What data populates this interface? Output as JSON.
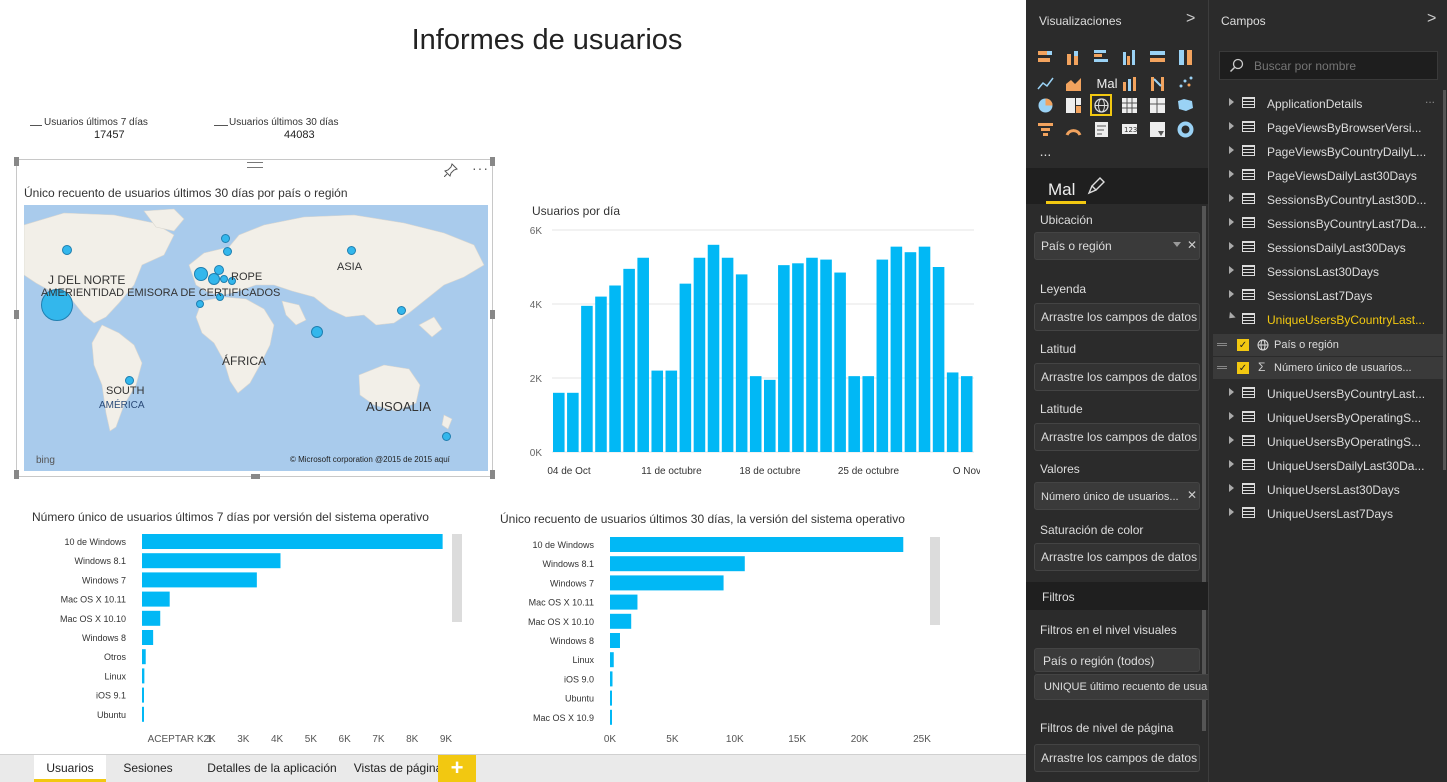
{
  "report": {
    "title": "Informes de usuarios",
    "cards": [
      {
        "label": "Usuarios últimos 7 días",
        "value": "17457"
      },
      {
        "label": "Usuarios últimos 30 días",
        "value": "44083"
      }
    ]
  },
  "map_visual": {
    "title": "Único recuento de usuarios últimos 30 días por país o región",
    "labels": {
      "north_america_1": "J DEL NORTE",
      "north_america_2": "AMERIENTIDAD EMISORA DE CERTIFICADOS",
      "europe": "ROPE",
      "asia": "ASIA",
      "africa": "ÁFRICA",
      "south_1": "SOUTH",
      "south_2": "AMÉRICA",
      "australia": "AUSOALIA",
      "bing": "bing",
      "copyright": "© Microsoft corporation @2015 de 2015 aquí"
    }
  },
  "chart_data": [
    {
      "type": "bar",
      "title": "Usuarios por día",
      "categories": [
        "04 de Oct",
        "",
        "",
        "",
        "",
        "",
        "",
        "11 de octubre",
        "",
        "",
        "",
        "",
        "",
        "",
        "18 de octubre",
        "",
        "",
        "",
        "",
        "",
        "",
        "25 de octubre",
        "",
        "",
        "",
        "",
        "",
        "",
        "O Nov"
      ],
      "x_tick_labels": [
        "04 de Oct",
        "11 de octubre",
        "18 de octubre",
        "25 de octubre",
        "O Nov"
      ],
      "y_tick_labels": [
        "0K",
        "2K",
        "4K",
        "6K"
      ],
      "values": [
        1600,
        1600,
        3950,
        4200,
        4500,
        4950,
        5250,
        2200,
        2200,
        4550,
        5250,
        5600,
        5250,
        4800,
        2050,
        1950,
        5050,
        5100,
        5250,
        5200,
        4850,
        2050,
        2050,
        5200,
        5550,
        5400,
        5550,
        5000,
        2150,
        2050
      ],
      "ylim": [
        0,
        6000
      ],
      "grid": true
    },
    {
      "type": "bar",
      "orientation": "horizontal",
      "title": "Número único de usuarios últimos 7 días por versión del sistema operativo",
      "categories": [
        "10 de Windows",
        "Windows 8.1",
        "Windows 7",
        "Mac OS X 10.11",
        "Mac OS X 10.10",
        "Windows 8",
        "Otros",
        "Linux",
        "iOS 9.1",
        "Ubuntu"
      ],
      "values": [
        8900,
        4100,
        3400,
        820,
        540,
        330,
        110,
        70,
        50,
        30
      ],
      "x_tick_labels": [
        "ACEPTAR K 1",
        "2K",
        "3K",
        "4K",
        "5K",
        "6K",
        "7K",
        "8K",
        "9K"
      ],
      "xlim": [
        0,
        9000
      ]
    },
    {
      "type": "bar",
      "orientation": "horizontal",
      "title": "Único recuento de usuarios últimos 30 días, la versión del sistema operativo",
      "categories": [
        "10 de Windows",
        "Windows 8.1",
        "Windows 7",
        "Mac OS X 10.11",
        "Mac OS X 10.10",
        "Windows 8",
        "Linux",
        "iOS 9.0",
        "Ubuntu",
        "Mac OS X 10.9"
      ],
      "values": [
        23500,
        10800,
        9100,
        2200,
        1700,
        800,
        300,
        200,
        150,
        100
      ],
      "x_tick_labels": [
        "0K",
        "5K",
        "10K",
        "15K",
        "20K",
        "25K"
      ],
      "xlim": [
        0,
        25000
      ]
    }
  ],
  "tabs": [
    {
      "label": "Usuarios",
      "active": true
    },
    {
      "label": "Sesiones",
      "active": false
    },
    {
      "label": "Detalles de la aplicación",
      "active": false
    },
    {
      "label": "Vistas de página",
      "active": false
    }
  ],
  "add_tab_label": "+",
  "viz_pane": {
    "title": "Visualizaciones",
    "chevron": ">",
    "more": "...",
    "fields_tab_label": "Mal",
    "grid_text_icon": "Mal",
    "wells": [
      {
        "label": "Ubicación",
        "value": "País o región",
        "filled": true
      },
      {
        "label": "Leyenda",
        "value": "Arrastre los campos de datos aquí",
        "filled": false
      },
      {
        "label": "Latitud",
        "value": "Arrastre los campos de datos aquí",
        "filled": false
      },
      {
        "label": "Latitude",
        "value": "Arrastre los campos de datos aquí",
        "filled": false
      },
      {
        "label": "Valores",
        "value": "Número único de usuarios...",
        "filled": true
      },
      {
        "label": "Saturación de color",
        "value": "Arrastre los campos de datos aquí",
        "filled": false
      }
    ],
    "filters": {
      "title": "Filtros",
      "visual_level_label": "Filtros en el nivel visuales",
      "visual_filters": [
        "País o región (todos)",
        "UNIQUE último recuento de usuarios..."
      ],
      "page_level_label": "Filtros de nivel de página",
      "page_level_placeholder": "Arrastre los campos de datos aquí"
    }
  },
  "fields_pane": {
    "title": "Campos",
    "chevron": ">",
    "search_placeholder": "Buscar por nombre",
    "tables_before": [
      "ApplicationDetails",
      "PageViewsByBrowserVersi...",
      "PageViewsByCountryDailyL...",
      "PageViewsDailyLast30Days",
      "SessionsByCountryLast30D...",
      "SessionsByCountryLast7Da...",
      "SessionsDailyLast30Days",
      "SessionsLast30Days",
      "SessionsLast7Days"
    ],
    "expanded_table": "UniqueUsersByCountryLast...",
    "expanded_fields": [
      "País o región",
      "Número único de usuarios..."
    ],
    "tables_after": [
      "UniqueUsersByCountryLast...",
      "UniqueUsersByOperatingS...",
      "UniqueUsersByOperatingS...",
      "UniqueUsersDailyLast30Da...",
      "UniqueUsersLast30Days",
      "UniqueUsersLast7Days"
    ],
    "more": "..."
  },
  "colors": {
    "bar": "#01b8f5",
    "accent": "#f2c811",
    "pane_bg": "#2b2b2b"
  }
}
